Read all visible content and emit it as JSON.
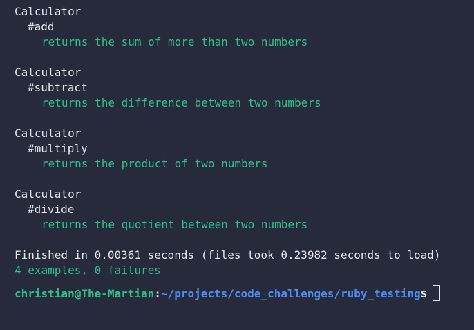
{
  "groups": [
    {
      "name": "Calculator",
      "method": "#add",
      "example": "returns the sum of more than two numbers"
    },
    {
      "name": "Calculator",
      "method": "#subtract",
      "example": "returns the difference between two numbers"
    },
    {
      "name": "Calculator",
      "method": "#multiply",
      "example": "returns the product of two numbers"
    },
    {
      "name": "Calculator",
      "method": "#divide",
      "example": "returns the quotient between two numbers"
    }
  ],
  "finished": "Finished in 0.00361 seconds (files took 0.23982 seconds to load)",
  "summary": "4 examples, 0 failures",
  "prompt": {
    "user_host": "christian@The-Martian",
    "colon": ":",
    "path": "~/projects/code_challenges/ruby_testing",
    "dollar": "$"
  },
  "colors": {
    "background": "#272a3b",
    "text": "#e6e6ea",
    "success": "#2fc08f",
    "path": "#4d8df4"
  }
}
